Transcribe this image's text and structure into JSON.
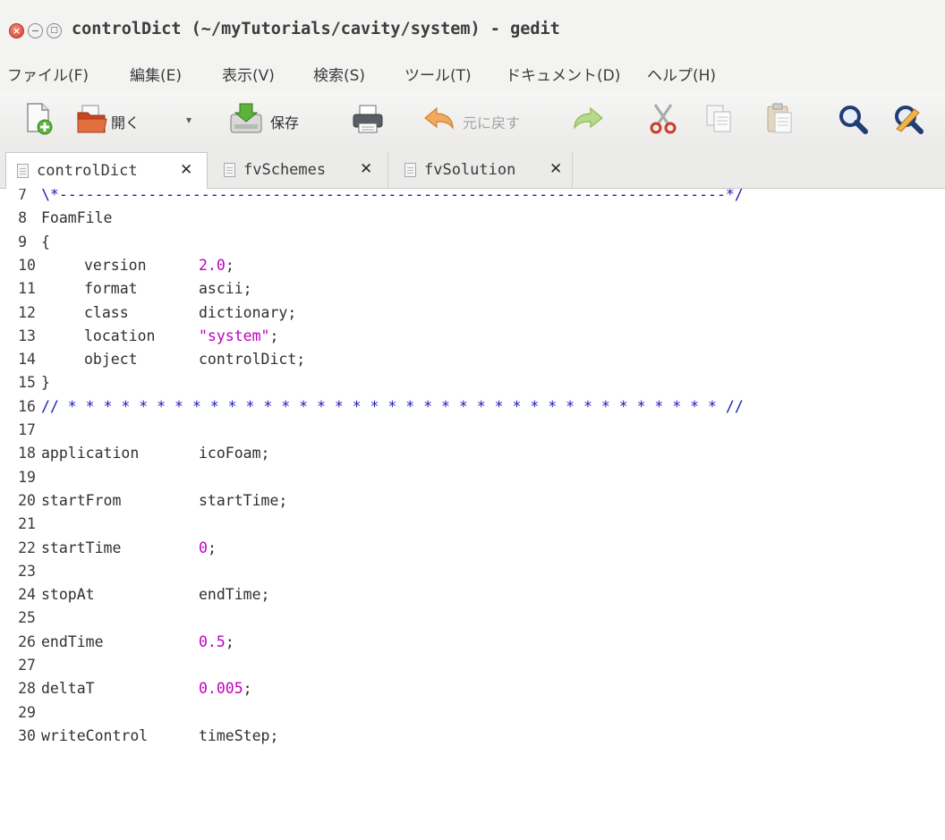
{
  "window": {
    "title": "controlDict (~/myTutorials/cavity/system) - gedit",
    "close_glyph": "×",
    "minimize_glyph": "−",
    "maximize_glyph": "□"
  },
  "menu": {
    "items": [
      {
        "label": "ファイル(F)"
      },
      {
        "label": "編集(E)"
      },
      {
        "label": "表示(V)"
      },
      {
        "label": "検索(S)"
      },
      {
        "label": "ツール(T)"
      },
      {
        "label": "ドキュメント(D)"
      },
      {
        "label": "ヘルプ(H)"
      }
    ]
  },
  "toolbar": {
    "new_icon": "new-document-icon",
    "open_label": "開く",
    "open_dropdown_glyph": "▾",
    "save_label": "保存",
    "print_icon": "printer-icon",
    "undo_label": "元に戻す",
    "redo_icon": "redo-icon",
    "cut_icon": "scissors-icon",
    "copy_icon": "copy-icon",
    "paste_icon": "paste-icon",
    "search_icon": "search-icon",
    "replace_icon": "search-replace-icon"
  },
  "tabs": [
    {
      "label": "controlDict",
      "close": "✕",
      "active": true
    },
    {
      "label": "fvSchemes",
      "close": "✕",
      "active": false
    },
    {
      "label": "fvSolution",
      "close": "✕",
      "active": false
    }
  ],
  "colors": {
    "number": "#c000c0",
    "string": "#c000c0",
    "comment": "#1b1bb5",
    "text": "#2f2f2f"
  },
  "editor": {
    "lines": [
      {
        "n": "7",
        "text": "\\*---------------------------------------------------------------------------*/"
      },
      {
        "n": "8",
        "text": "FoamFile"
      },
      {
        "n": "9",
        "text": "{"
      },
      {
        "n": "10",
        "key": "version",
        "val": "2.0",
        "suffix": ";"
      },
      {
        "n": "11",
        "key": "format",
        "val": "ascii;"
      },
      {
        "n": "12",
        "key": "class",
        "val": "dictionary;"
      },
      {
        "n": "13",
        "key": "location",
        "val": "\"system\"",
        "suffix": ";"
      },
      {
        "n": "14",
        "key": "object",
        "val": "controlDict;"
      },
      {
        "n": "15",
        "text": "}"
      },
      {
        "n": "16",
        "text": "// * * * * * * * * * * * * * * * * * * * * * * * * * * * * * * * * * * * * * //"
      },
      {
        "n": "17",
        "text": ""
      },
      {
        "n": "18",
        "key": "application",
        "val": "icoFoam;"
      },
      {
        "n": "19",
        "text": ""
      },
      {
        "n": "20",
        "key": "startFrom",
        "val": "startTime;"
      },
      {
        "n": "21",
        "text": ""
      },
      {
        "n": "22",
        "key": "startTime",
        "val": "0",
        "suffix": ";"
      },
      {
        "n": "23",
        "text": ""
      },
      {
        "n": "24",
        "key": "stopAt",
        "val": "endTime;"
      },
      {
        "n": "25",
        "text": ""
      },
      {
        "n": "26",
        "key": "endTime",
        "val": "0.5",
        "suffix": ";"
      },
      {
        "n": "27",
        "text": ""
      },
      {
        "n": "28",
        "key": "deltaT",
        "val": "0.005",
        "suffix": ";"
      },
      {
        "n": "29",
        "text": ""
      },
      {
        "n": "30",
        "key": "writeControl",
        "val": "timeStep;"
      }
    ]
  }
}
